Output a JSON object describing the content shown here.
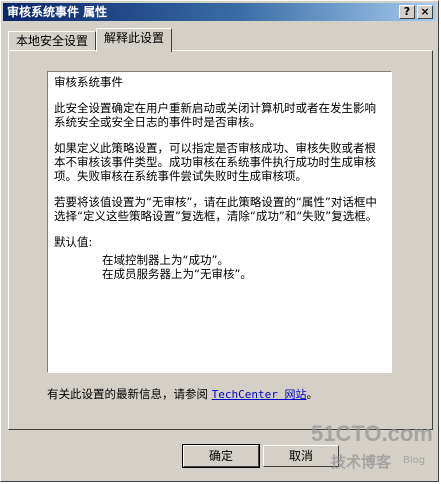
{
  "window": {
    "title": "审核系统事件  属性",
    "help_glyph": "?",
    "close_glyph": "×"
  },
  "tabs": [
    {
      "label": "本地安全设置"
    },
    {
      "label": "解释此设置",
      "active": true
    }
  ],
  "explain": {
    "heading": "审核系统事件",
    "para1": "此安全设置确定在用户重新启动或关闭计算机时或者在发生影响系统安全或安全日志的事件时是否审核。",
    "para2": "如果定义此策略设置，可以指定是否审核成功、审核失败或者根本不审核该事件类型。成功审核在系统事件执行成功时生成审核项。失败审核在系统事件尝试失败时生成审核项。",
    "para3": "若要将该值设置为“无审核”，请在此策略设置的“属性”对话框中选择“定义这些策略设置”复选框，清除“成功”和“失败”复选框。",
    "defaults_label": "默认值:",
    "default_dc": "在域控制器上为“成功”。",
    "default_member": "在成员服务器上为“无审核”。"
  },
  "more_info": {
    "prefix": "有关此设置的最新信息，请参阅 ",
    "link_text": "TechCenter 网站",
    "suffix": "。"
  },
  "buttons": {
    "ok": "确定",
    "cancel": "取消"
  },
  "watermark": {
    "main": "51CTO.com",
    "sub": "技术博客",
    "blog": "Blog"
  }
}
